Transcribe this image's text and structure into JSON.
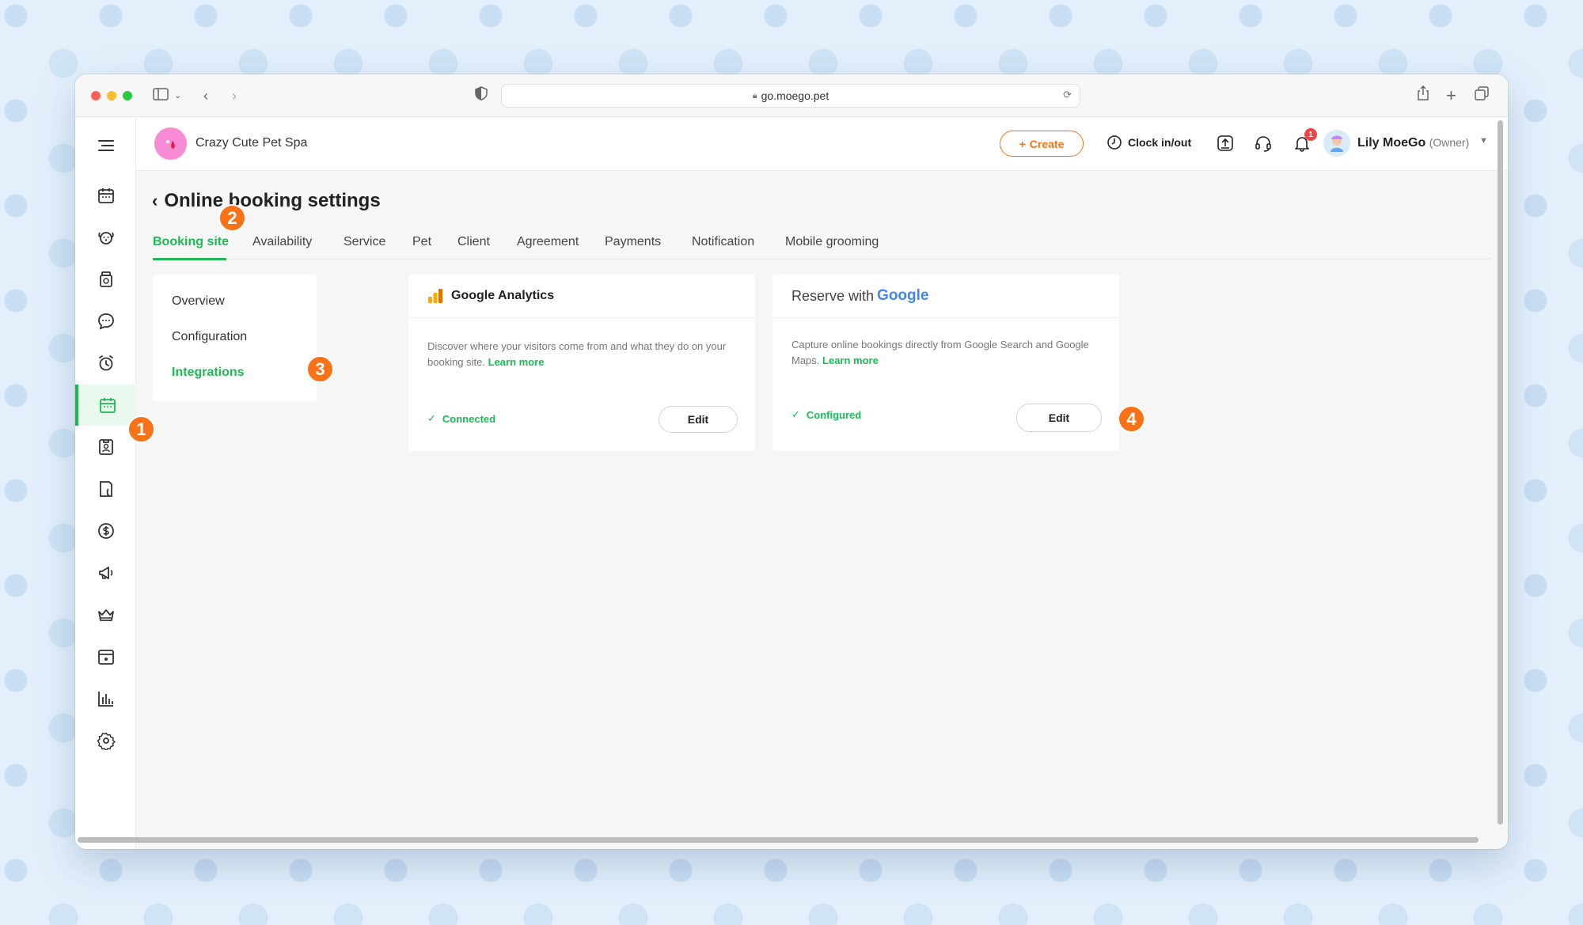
{
  "browser": {
    "url": "go.moego.pet"
  },
  "app": {
    "business_name": "Crazy Cute Pet Spa",
    "create_label": "Create",
    "clock_label": "Clock in/out",
    "notification_count": "1",
    "user_name": "Lily MoeGo",
    "user_role": "(Owner)"
  },
  "page": {
    "title": "Online booking settings",
    "tabs": [
      "Booking site",
      "Availability",
      "Service",
      "Pet",
      "Client",
      "Agreement",
      "Payments",
      "Notification",
      "Mobile grooming"
    ],
    "active_tab": "Booking site"
  },
  "left_menu": {
    "items": [
      "Overview",
      "Configuration",
      "Integrations"
    ],
    "active": "Integrations"
  },
  "cards": {
    "ga": {
      "title": "Google Analytics",
      "desc": "Discover where your visitors come from and what they do on your booking site.",
      "learn_more": "Learn more",
      "status": "Connected",
      "edit_label": "Edit"
    },
    "rwg": {
      "title_prefix": "Reserve with",
      "title_google": "Google",
      "desc": "Capture online bookings directly from Google Search and Google Maps.",
      "learn_more": "Learn more",
      "status": "Configured",
      "edit_label": "Edit"
    }
  },
  "steps": [
    "1",
    "2",
    "3",
    "4"
  ],
  "colors": {
    "accent_green": "#1db954",
    "accent_orange": "#f97316",
    "badge_red": "#ef4444"
  },
  "sidebar_icons": [
    "menu-icon",
    "calendar-icon",
    "pet-icon",
    "jar-icon",
    "chat-icon",
    "alarm-icon",
    "booking-calendar-icon",
    "staff-badge-icon",
    "invoice-icon",
    "dollar-icon",
    "megaphone-icon",
    "crown-icon",
    "schedule-icon",
    "reports-icon",
    "settings-icon"
  ]
}
